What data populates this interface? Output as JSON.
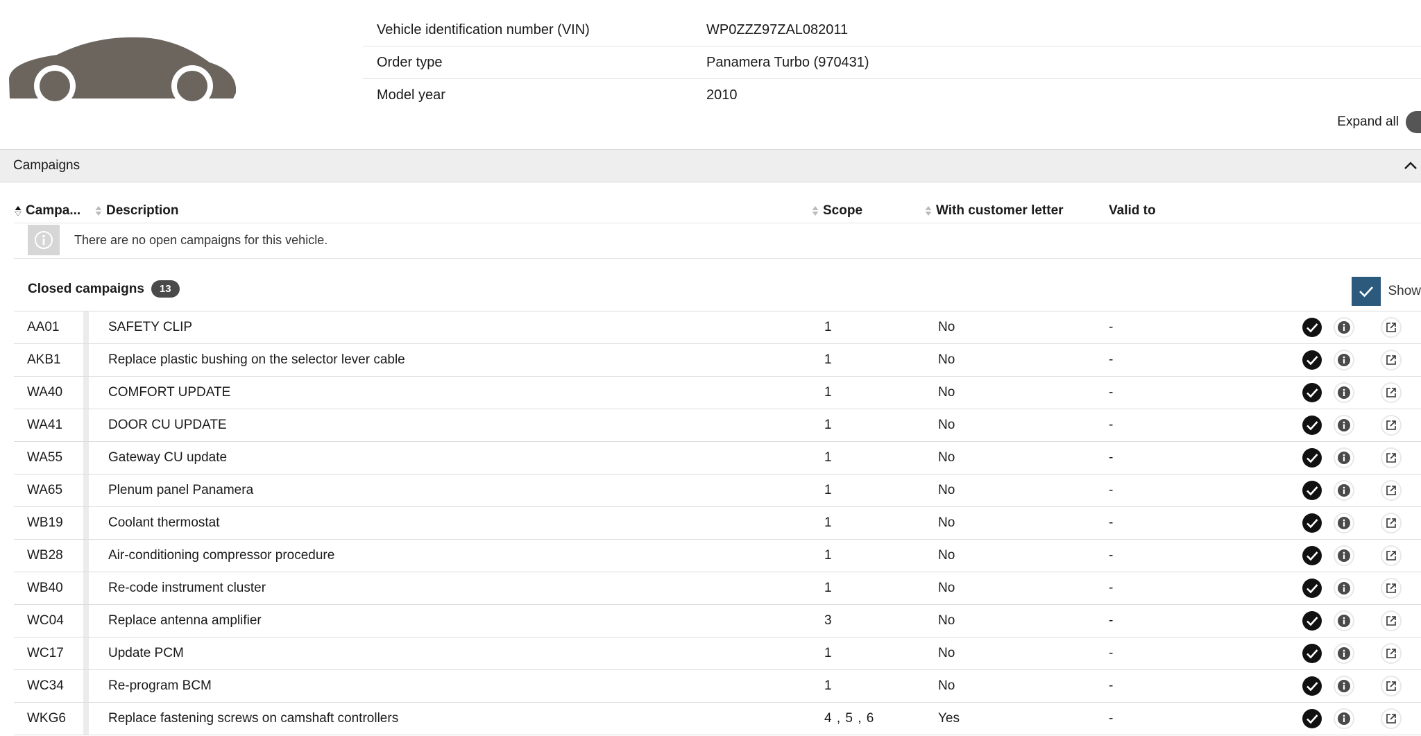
{
  "vehicle": {
    "fields": [
      {
        "label": "Vehicle identification number (VIN)",
        "value": "WP0ZZZ97ZAL082011"
      },
      {
        "label": "Order type",
        "value": "Panamera Turbo (970431)"
      },
      {
        "label": "Model year",
        "value": "2010"
      }
    ],
    "expand_all_label": "Expand all"
  },
  "campaigns": {
    "section_title": "Campaigns",
    "columns": {
      "campaign": "Campa...",
      "description": "Description",
      "scope": "Scope",
      "customer_letter": "With customer letter",
      "valid_to": "Valid to"
    },
    "no_open_message": "There are no open campaigns for this vehicle.",
    "closed": {
      "title": "Closed campaigns",
      "count": "13",
      "show_label": "Show",
      "rows": [
        {
          "code": "AA01",
          "description": "SAFETY CLIP",
          "scope": "1",
          "customer_letter": "No",
          "valid_to": "-"
        },
        {
          "code": "AKB1",
          "description": "Replace plastic bushing on the selector lever cable",
          "scope": "1",
          "customer_letter": "No",
          "valid_to": "-"
        },
        {
          "code": "WA40",
          "description": "COMFORT UPDATE",
          "scope": "1",
          "customer_letter": "No",
          "valid_to": "-"
        },
        {
          "code": "WA41",
          "description": "DOOR CU UPDATE",
          "scope": "1",
          "customer_letter": "No",
          "valid_to": "-"
        },
        {
          "code": "WA55",
          "description": "Gateway CU update",
          "scope": "1",
          "customer_letter": "No",
          "valid_to": "-"
        },
        {
          "code": "WA65",
          "description": "Plenum panel Panamera",
          "scope": "1",
          "customer_letter": "No",
          "valid_to": "-"
        },
        {
          "code": "WB19",
          "description": "Coolant thermostat",
          "scope": "1",
          "customer_letter": "No",
          "valid_to": "-"
        },
        {
          "code": "WB28",
          "description": "Air-conditioning compressor procedure",
          "scope": "1",
          "customer_letter": "No",
          "valid_to": "-"
        },
        {
          "code": "WB40",
          "description": "Re-code instrument cluster",
          "scope": "1",
          "customer_letter": "No",
          "valid_to": "-"
        },
        {
          "code": "WC04",
          "description": "Replace antenna amplifier",
          "scope": "3",
          "customer_letter": "No",
          "valid_to": "-"
        },
        {
          "code": "WC17",
          "description": "Update PCM",
          "scope": "1",
          "customer_letter": "No",
          "valid_to": "-"
        },
        {
          "code": "WC34",
          "description": "Re-program BCM",
          "scope": "1",
          "customer_letter": "No",
          "valid_to": "-"
        },
        {
          "code": "WKG6",
          "description": "Replace fastening screws on camshaft controllers",
          "scope": "4 , 5 , 6",
          "customer_letter": "Yes",
          "valid_to": "-"
        }
      ]
    }
  },
  "icons": {
    "vehicle": "car-silhouette-icon",
    "collapse": "chevron-up-icon",
    "sort": "sort-icon",
    "info": "info-icon",
    "show_checkbox": "checkmark-icon",
    "status": "check-circle-icon",
    "details": "info-circle-icon",
    "open": "external-link-icon"
  },
  "colors": {
    "section_bar": "#eeeeef",
    "checkbox": "#2c5a7d",
    "badge": "#4a4a4a",
    "car": "#6b655e"
  }
}
